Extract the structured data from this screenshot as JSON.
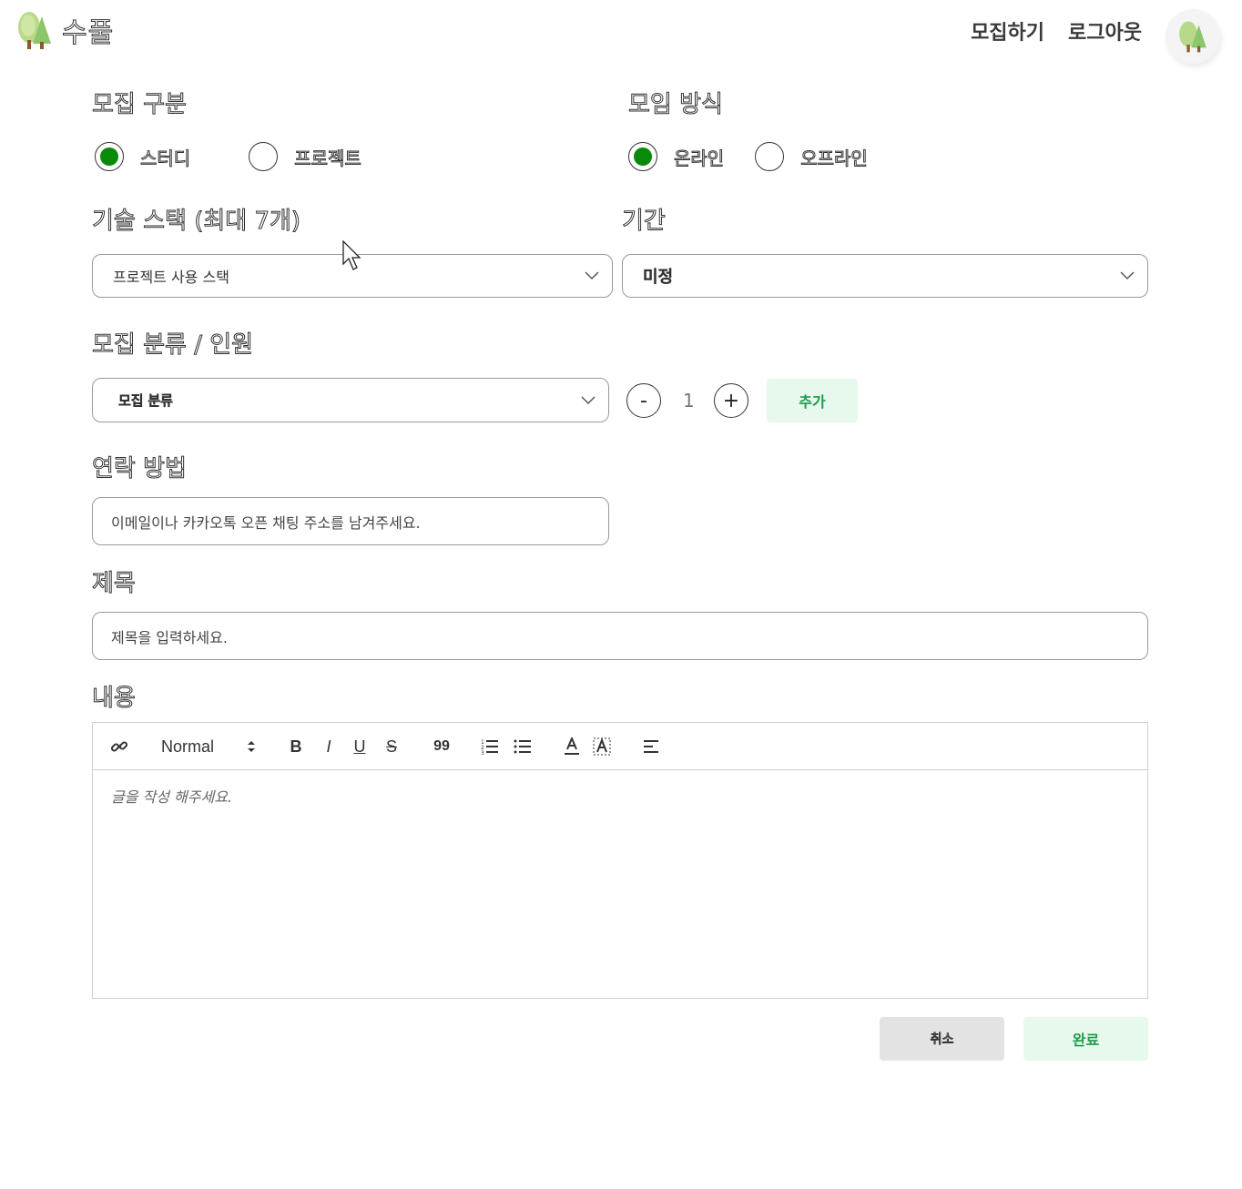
{
  "header": {
    "logo_text": "수풀",
    "nav": [
      "모집하기",
      "로그아웃"
    ]
  },
  "form": {
    "recruit_type": {
      "label": "모집 구분",
      "options": [
        "스터디",
        "프로젝트"
      ],
      "selected": "스터디"
    },
    "meeting_method": {
      "label": "모임 방식",
      "options": [
        "온라인",
        "오프라인"
      ],
      "selected": "온라인"
    },
    "tech_stack": {
      "label": "기술 스택 (최대 7개)",
      "placeholder": "프로젝트 사용 스택"
    },
    "period": {
      "label": "기간",
      "value": "미정"
    },
    "recruit_category": {
      "label": "모집 분류 / 인원",
      "placeholder": "모집 분류",
      "count": "1",
      "minus": "-",
      "plus": "+",
      "add_label": "추가"
    },
    "contact": {
      "label": "연락 방법",
      "placeholder": "이메일이나 카카오톡 오픈 채팅 주소를 남겨주세요."
    },
    "title": {
      "label": "제목",
      "placeholder": "제목을 입력하세요."
    },
    "content": {
      "label": "내용",
      "toolbar": {
        "heading": "Normal",
        "bold": "B",
        "italic": "I",
        "underline": "U",
        "strike": "S",
        "quote": "99"
      },
      "placeholder": "글을 작성 해주세요."
    }
  },
  "actions": {
    "cancel": "취소",
    "done": "완료"
  },
  "colors": {
    "radio_selected": "#0a8a0a",
    "accent_bg": "#e7f8ec",
    "accent_text": "#1e9a4a",
    "cancel_bg": "#e3e3e3"
  }
}
